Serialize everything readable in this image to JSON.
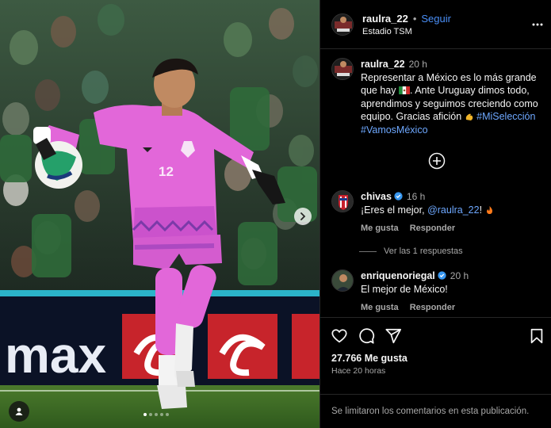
{
  "post": {
    "username": "raulra_22",
    "follow_label": "Seguir",
    "separator": "•",
    "location": "Estadio TSM",
    "more_label": "Más opciones"
  },
  "caption": {
    "username": "raulra_22",
    "time": "20 h",
    "text_before_flag": "Representar a México es lo más grande que hay ",
    "text_after_flag": ". Ante Uruguay dimos todo, aprendimos y seguimos creciendo como equipo. Gracias afición ",
    "hashtag_1": "#MiSelección",
    "hashtag_2": "#VamosMéxico"
  },
  "comments": [
    {
      "username": "chivas",
      "time": "16 h",
      "text_before": "¡Eres el mejor, ",
      "mention": "@raulra_22",
      "text_after": "! ",
      "like_label": "Me gusta",
      "reply_label": "Responder",
      "view_replies": "Ver las 1 respuestas"
    },
    {
      "username": "enriquenoriegal",
      "time": "20 h",
      "text": "El mejor de México!",
      "like_label": "Me gusta",
      "reply_label": "Responder"
    }
  ],
  "stats": {
    "likes": "27.766 Me gusta",
    "posted": "Hace 20 horas"
  },
  "footer": {
    "comments_limited": "Se limitaron los comentarios en esta publicación."
  },
  "photo": {
    "jersey_number": "12",
    "carousel_total": 5,
    "carousel_active": 1
  },
  "colors": {
    "link_blue": "#4a8ff7",
    "jersey_pink": "#e267d9",
    "muted": "#a8a8a8"
  }
}
